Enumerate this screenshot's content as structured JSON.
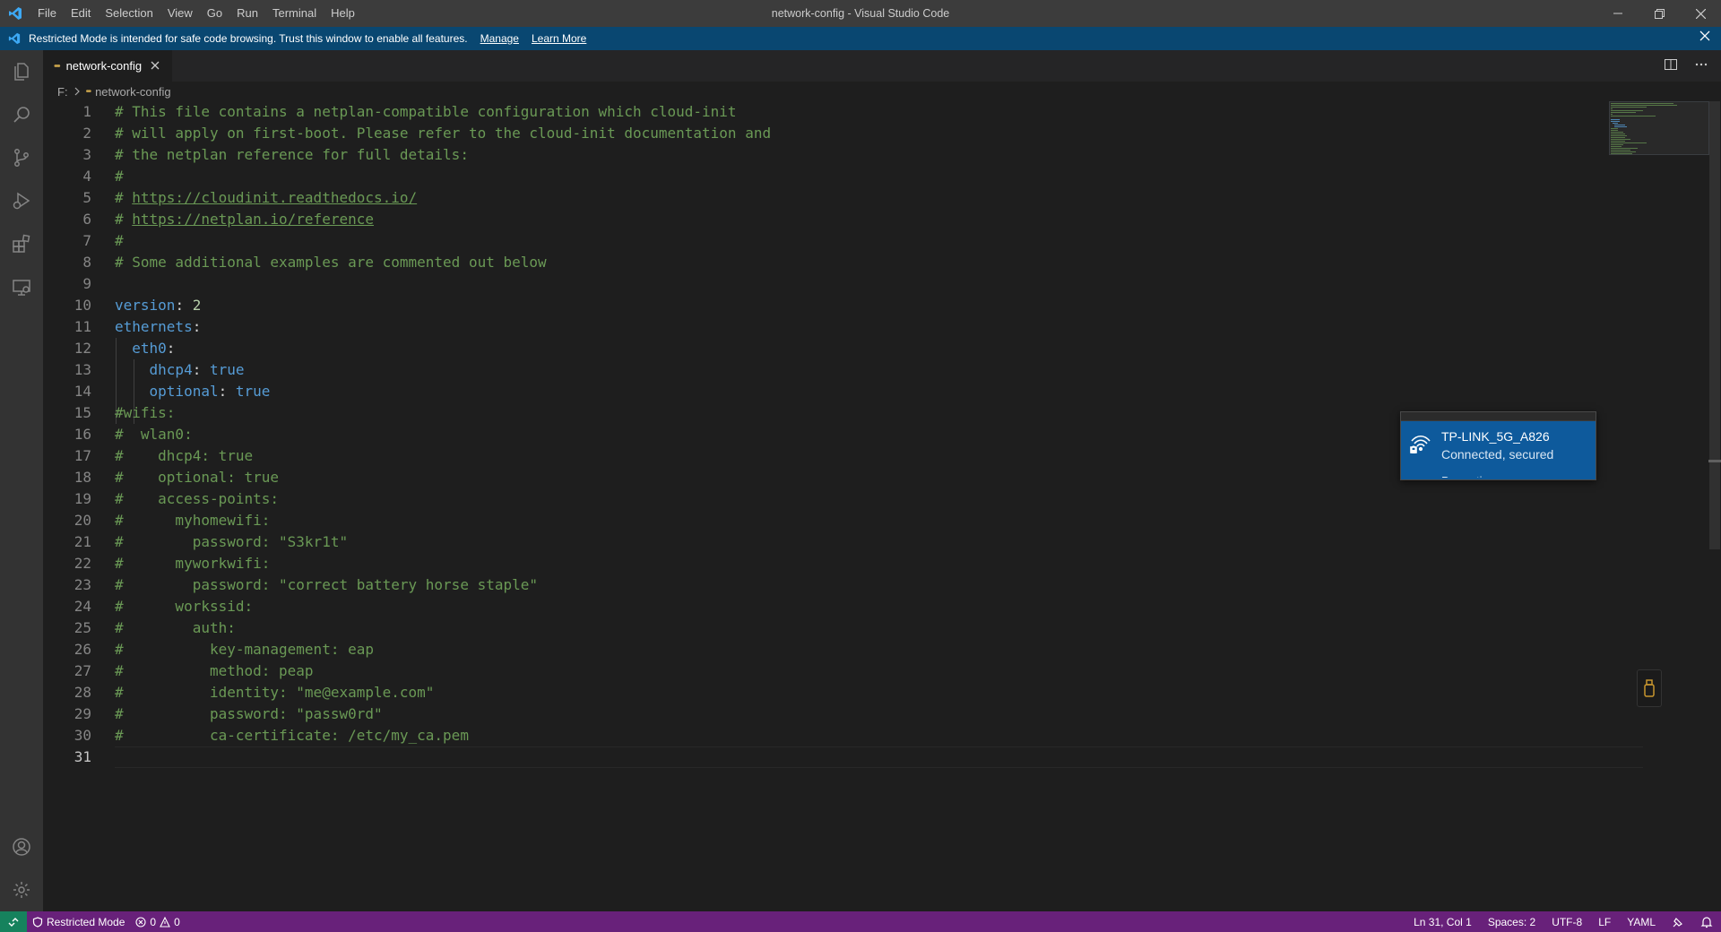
{
  "window": {
    "title": "network-config - Visual Studio Code",
    "menu": [
      "File",
      "Edit",
      "Selection",
      "View",
      "Go",
      "Run",
      "Terminal",
      "Help"
    ]
  },
  "banner": {
    "message": "Restricted Mode is intended for safe code browsing. Trust this window to enable all features.",
    "manage_label": "Manage",
    "learn_more_label": "Learn More"
  },
  "tab": {
    "label": "network-config",
    "file_icon": "yaml-icon"
  },
  "breadcrumb": {
    "drive": "F:",
    "file": "network-config"
  },
  "editor": {
    "active_line": 31,
    "lines": [
      "# This file contains a netplan-compatible configuration which cloud-init",
      "# will apply on first-boot. Please refer to the cloud-init documentation and",
      "# the netplan reference for full details:",
      "#",
      "# https://cloudinit.readthedocs.io/",
      "# https://netplan.io/reference",
      "#",
      "# Some additional examples are commented out below",
      "",
      "version: 2",
      "ethernets:",
      "  eth0:",
      "    dhcp4: true",
      "    optional: true",
      "#wifis:",
      "#  wlan0:",
      "#    dhcp4: true",
      "#    optional: true",
      "#    access-points:",
      "#      myhomewifi:",
      "#        password: \"S3kr1t\"",
      "#      myworkwifi:",
      "#        password: \"correct battery horse staple\"",
      "#      workssid:",
      "#        auth:",
      "#          key-management: eap",
      "#          method: peap",
      "#          identity: \"me@example.com\"",
      "#          password: \"passw0rd\"",
      "#          ca-certificate: /etc/my_ca.pem",
      ""
    ]
  },
  "wifi_popup": {
    "ssid": "TP-LINK_5G_A826",
    "status": "Connected, secured",
    "cut_text": "Properties"
  },
  "statusbar": {
    "restricted_label": "Restricted Mode",
    "errors": "0",
    "warnings": "0",
    "position": "Ln 31, Col 1",
    "spaces": "Spaces: 2",
    "encoding": "UTF-8",
    "eol": "LF",
    "language": "YAML"
  },
  "colors": {
    "titlebar": "#3c3c3c",
    "banner": "#094771",
    "statusbar": "#68217a",
    "remote": "#16825d",
    "comment": "#6a9955",
    "keyword": "#569cd6",
    "number": "#b5cea8",
    "wifi_active": "#0e5a9c"
  }
}
